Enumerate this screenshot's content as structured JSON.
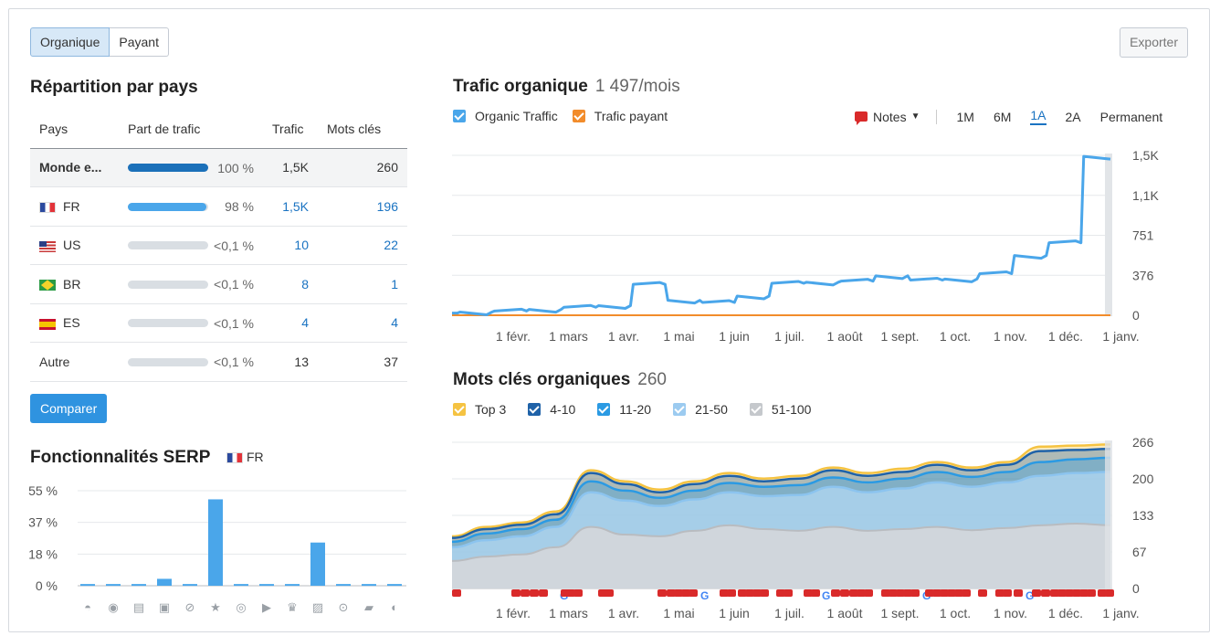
{
  "toggle": {
    "organic": "Organique",
    "paid": "Payant"
  },
  "export_label": "Exporter",
  "country": {
    "title": "Répartition par pays",
    "headers": [
      "Pays",
      "Part de trafic",
      "Trafic",
      "Mots clés"
    ],
    "rows": [
      {
        "name": "Monde e...",
        "share": 1.0,
        "pct": "100 %",
        "traffic": "1,5K",
        "keywords": "260",
        "flag": ""
      },
      {
        "name": "FR",
        "share": 0.98,
        "pct": "98 %",
        "traffic": "1,5K",
        "keywords": "196",
        "flag": "fr"
      },
      {
        "name": "US",
        "share": 0.0,
        "pct": "<0,1 %",
        "traffic": "10",
        "keywords": "22",
        "flag": "us"
      },
      {
        "name": "BR",
        "share": 0.0,
        "pct": "<0,1 %",
        "traffic": "8",
        "keywords": "1",
        "flag": "br"
      },
      {
        "name": "ES",
        "share": 0.0,
        "pct": "<0,1 %",
        "traffic": "4",
        "keywords": "4",
        "flag": "es"
      },
      {
        "name": "Autre",
        "share": 0.0,
        "pct": "<0,1 %",
        "traffic": "13",
        "keywords": "37",
        "flag": ""
      }
    ]
  },
  "compare_label": "Comparer",
  "serp": {
    "title": "Fonctionnalités SERP",
    "country": "FR",
    "y_ticks": [
      "55 %",
      "37 %",
      "18 %",
      "0 %"
    ],
    "icons": [
      "graduation-cap-icon",
      "map-pin-icon",
      "news-icon",
      "image-icon",
      "link-icon",
      "star-icon",
      "play-circle-icon",
      "video-icon",
      "crown-icon",
      "image-pack-icon",
      "play-icon",
      "question-icon",
      "help-circle-icon"
    ]
  },
  "traffic": {
    "title": "Trafic organique",
    "value": "1 497/mois",
    "legend": [
      {
        "label": "Organic Traffic",
        "color": "#4aa6ea"
      },
      {
        "label": "Trafic payant",
        "color": "#f28c2b"
      }
    ],
    "notes_label": "Notes",
    "periods": [
      "1M",
      "6M",
      "1A",
      "2A",
      "Permanent"
    ],
    "selected_period": "1A"
  },
  "keywords": {
    "title": "Mots clés organiques",
    "value": "260",
    "legend": [
      {
        "label": "Top 3",
        "color": "#f5c342"
      },
      {
        "label": "4-10",
        "color": "#1f62a8"
      },
      {
        "label": "11-20",
        "color": "#2b9ae3"
      },
      {
        "label": "21-50",
        "color": "#9ccbf0"
      },
      {
        "label": "51-100",
        "color": "#c5c8cc"
      }
    ]
  },
  "chart_data": [
    {
      "type": "line",
      "title": "Trafic organique",
      "x_ticks": [
        "1 févr.",
        "1 mars",
        "1 avr.",
        "1 mai",
        "1 juin",
        "1 juil.",
        "1 août",
        "1 sept.",
        "1 oct.",
        "1 nov.",
        "1 déc.",
        "1 janv."
      ],
      "y_ticks": [
        "0",
        "376",
        "751",
        "1,1K",
        "1,5K"
      ],
      "ylim": [
        0,
        1500
      ],
      "series": [
        {
          "name": "Organic Traffic",
          "values": [
            20,
            30,
            40,
            55,
            75,
            90,
            290,
            140,
            120,
            180,
            300,
            310,
            320,
            370,
            330,
            340,
            390,
            560,
            680,
            1490
          ]
        },
        {
          "name": "Trafic payant",
          "values": [
            0,
            0,
            0,
            0,
            0,
            0,
            0,
            0,
            0,
            0,
            0,
            0,
            0,
            0,
            0,
            0,
            0,
            0,
            0,
            0
          ]
        }
      ]
    },
    {
      "type": "area",
      "title": "Mots clés organiques",
      "x_ticks": [
        "1 févr.",
        "1 mars",
        "1 avr.",
        "1 mai",
        "1 juin",
        "1 juil.",
        "1 août",
        "1 sept.",
        "1 oct.",
        "1 nov.",
        "1 déc.",
        "1 janv."
      ],
      "y_ticks": [
        "0",
        "67",
        "133",
        "200",
        "266"
      ],
      "ylim": [
        0,
        266
      ],
      "series": [
        {
          "name": "Top 3",
          "values": [
            95,
            112,
            120,
            140,
            215,
            195,
            180,
            195,
            210,
            200,
            205,
            220,
            210,
            218,
            230,
            220,
            230,
            258,
            260,
            262
          ]
        },
        {
          "name": "4-10",
          "values": [
            92,
            108,
            116,
            135,
            210,
            190,
            175,
            190,
            205,
            195,
            200,
            215,
            205,
            212,
            225,
            215,
            225,
            250,
            252,
            254
          ]
        },
        {
          "name": "11-20",
          "values": [
            85,
            100,
            108,
            125,
            195,
            178,
            165,
            178,
            192,
            185,
            188,
            202,
            193,
            200,
            212,
            203,
            212,
            230,
            235,
            238
          ]
        },
        {
          "name": "21-50",
          "values": [
            75,
            88,
            95,
            112,
            175,
            160,
            150,
            162,
            175,
            168,
            170,
            185,
            175,
            182,
            193,
            185,
            193,
            205,
            210,
            212
          ]
        },
        {
          "name": "51-100",
          "values": [
            50,
            58,
            62,
            75,
            112,
            98,
            95,
            105,
            115,
            108,
            105,
            112,
            105,
            108,
            112,
            106,
            110,
            115,
            118,
            115
          ]
        }
      ]
    },
    {
      "type": "bar",
      "title": "Fonctionnalités SERP",
      "y_ticks": [
        "0 %",
        "18 %",
        "37 %",
        "55 %"
      ],
      "ylim": [
        0,
        55
      ],
      "categories": [
        "graduation-cap-icon",
        "map-pin-icon",
        "news-icon",
        "image-icon",
        "link-icon",
        "star-icon",
        "play-circle-icon",
        "video-icon",
        "crown-icon",
        "image-pack-icon",
        "play-icon",
        "question-icon",
        "help-circle-icon"
      ],
      "values": [
        1,
        1,
        1,
        4,
        1,
        50,
        1,
        1,
        1,
        25,
        1,
        1,
        1
      ]
    }
  ]
}
